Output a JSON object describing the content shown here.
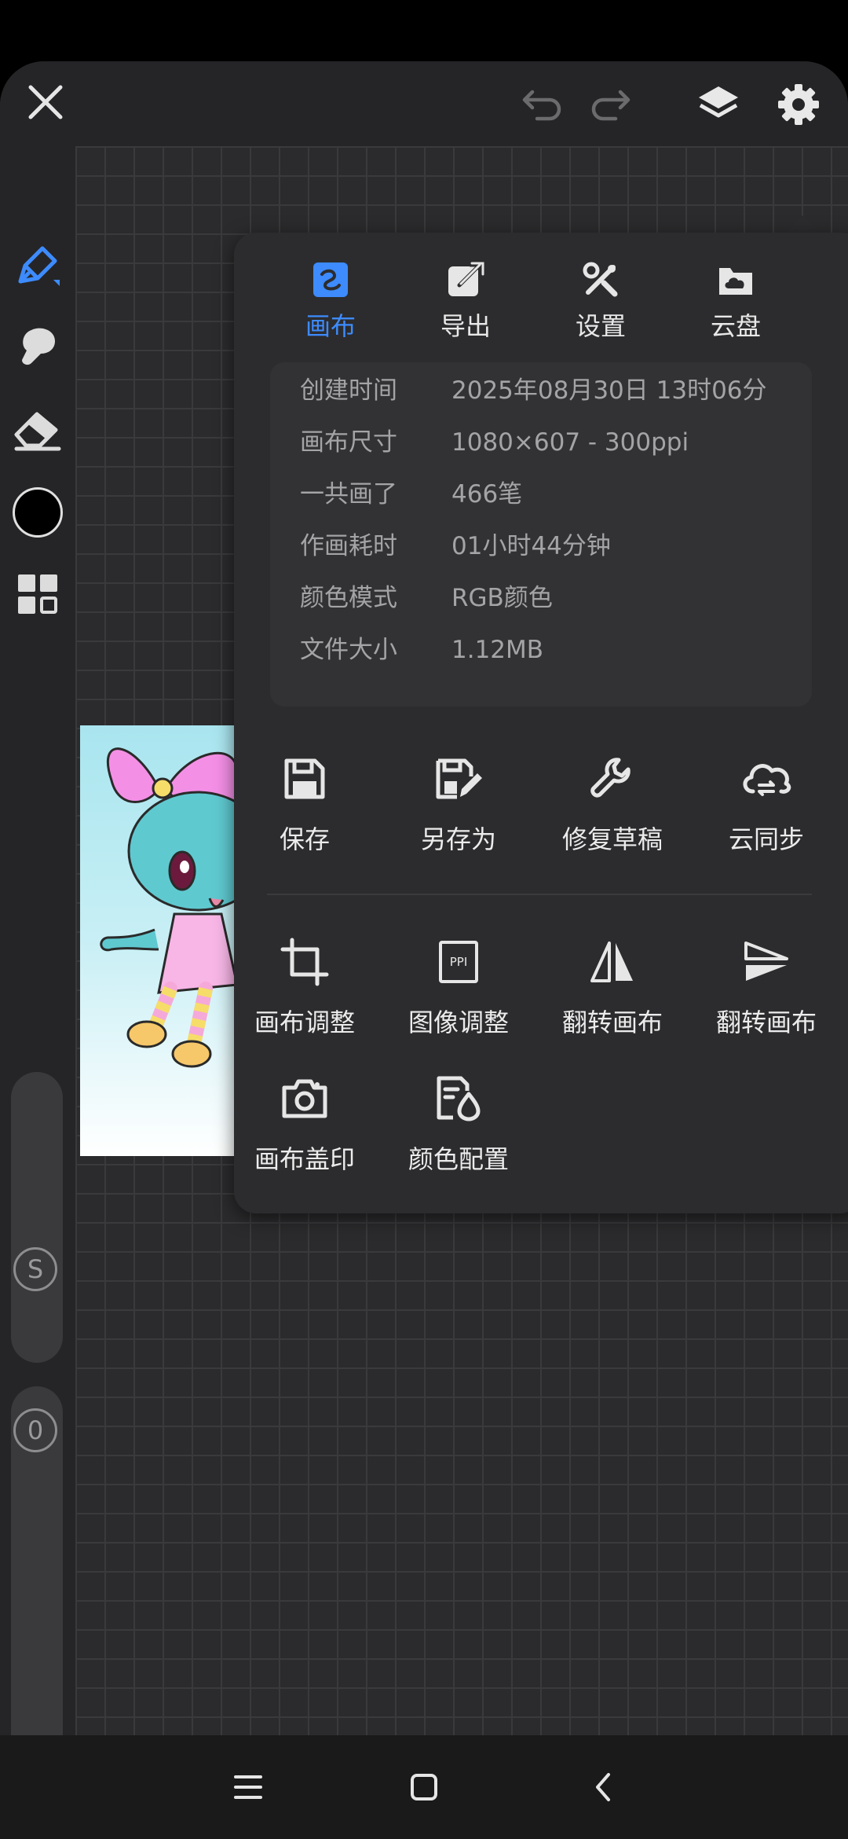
{
  "colors": {
    "accent": "#3d8bfd",
    "panel_bg": "#2c2c2e",
    "app_bg": "#232325",
    "current_color": "#000000"
  },
  "toolbar": {
    "icons": [
      "close-icon",
      "undo-icon",
      "redo-icon",
      "layers-icon",
      "gear-icon"
    ]
  },
  "left_tools": {
    "icons": [
      "brush-pen-icon",
      "smudge-icon",
      "eraser-icon",
      "color-swatch",
      "grid-menu-icon"
    ],
    "size_slider_label": "S",
    "opacity_slider_label": "0"
  },
  "settings_panel": {
    "tabs": [
      {
        "label": "画布",
        "icon": "canvas-icon",
        "active": true
      },
      {
        "label": "导出",
        "icon": "export-icon",
        "active": false
      },
      {
        "label": "设置",
        "icon": "settings-tools-icon",
        "active": false
      },
      {
        "label": "云盘",
        "icon": "cloud-drive-icon",
        "active": false
      }
    ],
    "info": [
      {
        "key": "创建时间",
        "value": "2025年08月30日 13时06分"
      },
      {
        "key": "画布尺寸",
        "value": "1080×607 - 300ppi"
      },
      {
        "key": "一共画了",
        "value": "466笔"
      },
      {
        "key": "作画耗时",
        "value": "01小时44分钟"
      },
      {
        "key": "颜色模式",
        "value": "RGB颜色"
      },
      {
        "key": "文件大小",
        "value": "1.12MB"
      }
    ],
    "actions_row1": [
      {
        "label": "保存",
        "icon": "save-icon"
      },
      {
        "label": "另存为",
        "icon": "save-as-icon"
      },
      {
        "label": "修复草稿",
        "icon": "wrench-icon"
      },
      {
        "label": "云同步",
        "icon": "cloud-sync-icon"
      }
    ],
    "actions_row2": [
      {
        "label": "画布调整",
        "icon": "crop-icon"
      },
      {
        "label": "图像调整",
        "icon": "ppi-icon"
      },
      {
        "label": "翻转画布",
        "icon": "flip-horizontal-icon"
      },
      {
        "label": "翻转画布",
        "icon": "flip-vertical-icon"
      }
    ],
    "actions_row3": [
      {
        "label": "画布盖印",
        "icon": "camera-icon"
      },
      {
        "label": "颜色配置",
        "icon": "color-config-icon"
      }
    ],
    "ppi_badge": "PPI"
  },
  "navbar": {
    "icons": [
      "menu-icon",
      "home-icon",
      "back-icon"
    ]
  }
}
